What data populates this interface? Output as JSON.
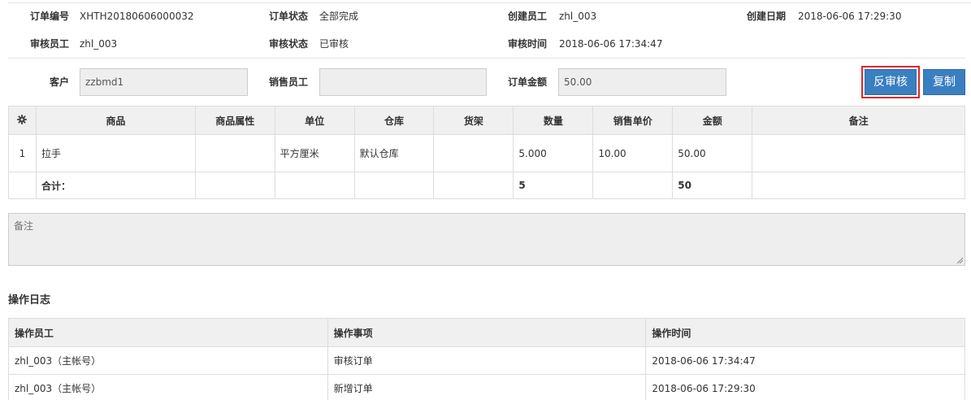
{
  "order_info": {
    "order_no_label": "订单编号",
    "order_no": "XHTH20180606000032",
    "status_label": "订单状态",
    "status": "全部完成",
    "creator_label": "创建员工",
    "creator": "zhl_003",
    "created_label": "创建日期",
    "created": "2018-06-06 17:29:30",
    "auditor_label": "审核员工",
    "auditor": "zhl_003",
    "audit_status_label": "审核状态",
    "audit_status": "已审核",
    "audit_time_label": "审核时间",
    "audit_time": "2018-06-06 17:34:47"
  },
  "form": {
    "customer_label": "客户",
    "customer": "zzbmd1",
    "sales_label": "销售员工",
    "sales": "",
    "amount_label": "订单金额",
    "amount": "50.00",
    "unaudit_button": "反审核",
    "copy_button": "复制"
  },
  "items_table": {
    "headers": [
      "商品",
      "商品属性",
      "单位",
      "仓库",
      "货架",
      "数量",
      "销售单价",
      "金额",
      "备注"
    ],
    "rows": [
      {
        "idx": "1",
        "product": "拉手",
        "attr": "",
        "unit": "平方厘米",
        "warehouse": "默认仓库",
        "shelf": "",
        "qty": "5.000",
        "price": "10.00",
        "amount": "50.00",
        "note": ""
      }
    ],
    "sum_label": "合计：",
    "sum_qty": "5",
    "sum_amount": "50"
  },
  "remark": {
    "placeholder": "备注"
  },
  "log": {
    "title": "操作日志",
    "headers": [
      "操作员工",
      "操作事项",
      "操作时间"
    ],
    "rows": [
      {
        "staff": "zhl_003（主帐号）",
        "action": "审核订单",
        "time": "2018-06-06 17:34:47"
      },
      {
        "staff": "zhl_003（主帐号）",
        "action": "新增订单",
        "time": "2018-06-06 17:29:30"
      }
    ]
  },
  "colors": {
    "button": "#3a7fc1",
    "highlight": "#e0262b",
    "input_bg": "#eeeeee",
    "header_bg": "#f0f0f0"
  }
}
